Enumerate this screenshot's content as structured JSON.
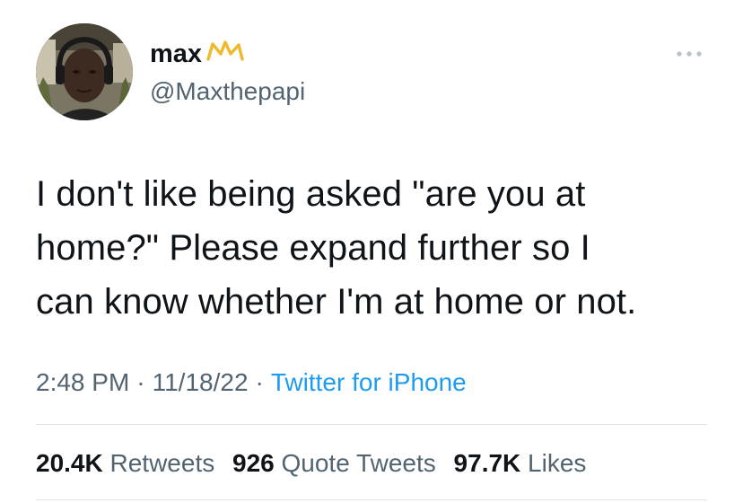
{
  "user": {
    "display_name": "max",
    "handle": "@Maxthepapi",
    "badge_icon": "crown-icon",
    "badge_color": "#f0b92b"
  },
  "more_icon": "ellipsis-icon",
  "tweet": {
    "text_lines": [
      "I don't like being asked \"are you at",
      "home?\" Please expand further so I",
      "can know whether I'm at home or not."
    ]
  },
  "meta": {
    "time": "2:48 PM",
    "date": "11/18/22",
    "source": "Twitter for iPhone",
    "separator": "·"
  },
  "stats": {
    "retweets_count": "20.4K",
    "retweets_label": "Retweets",
    "quotes_count": "926",
    "quotes_label": "Quote Tweets",
    "likes_count": "97.7K",
    "likes_label": "Likes"
  },
  "colors": {
    "link": "#1d9bf0",
    "secondary_text": "#536471",
    "primary_text": "#0f1419"
  }
}
